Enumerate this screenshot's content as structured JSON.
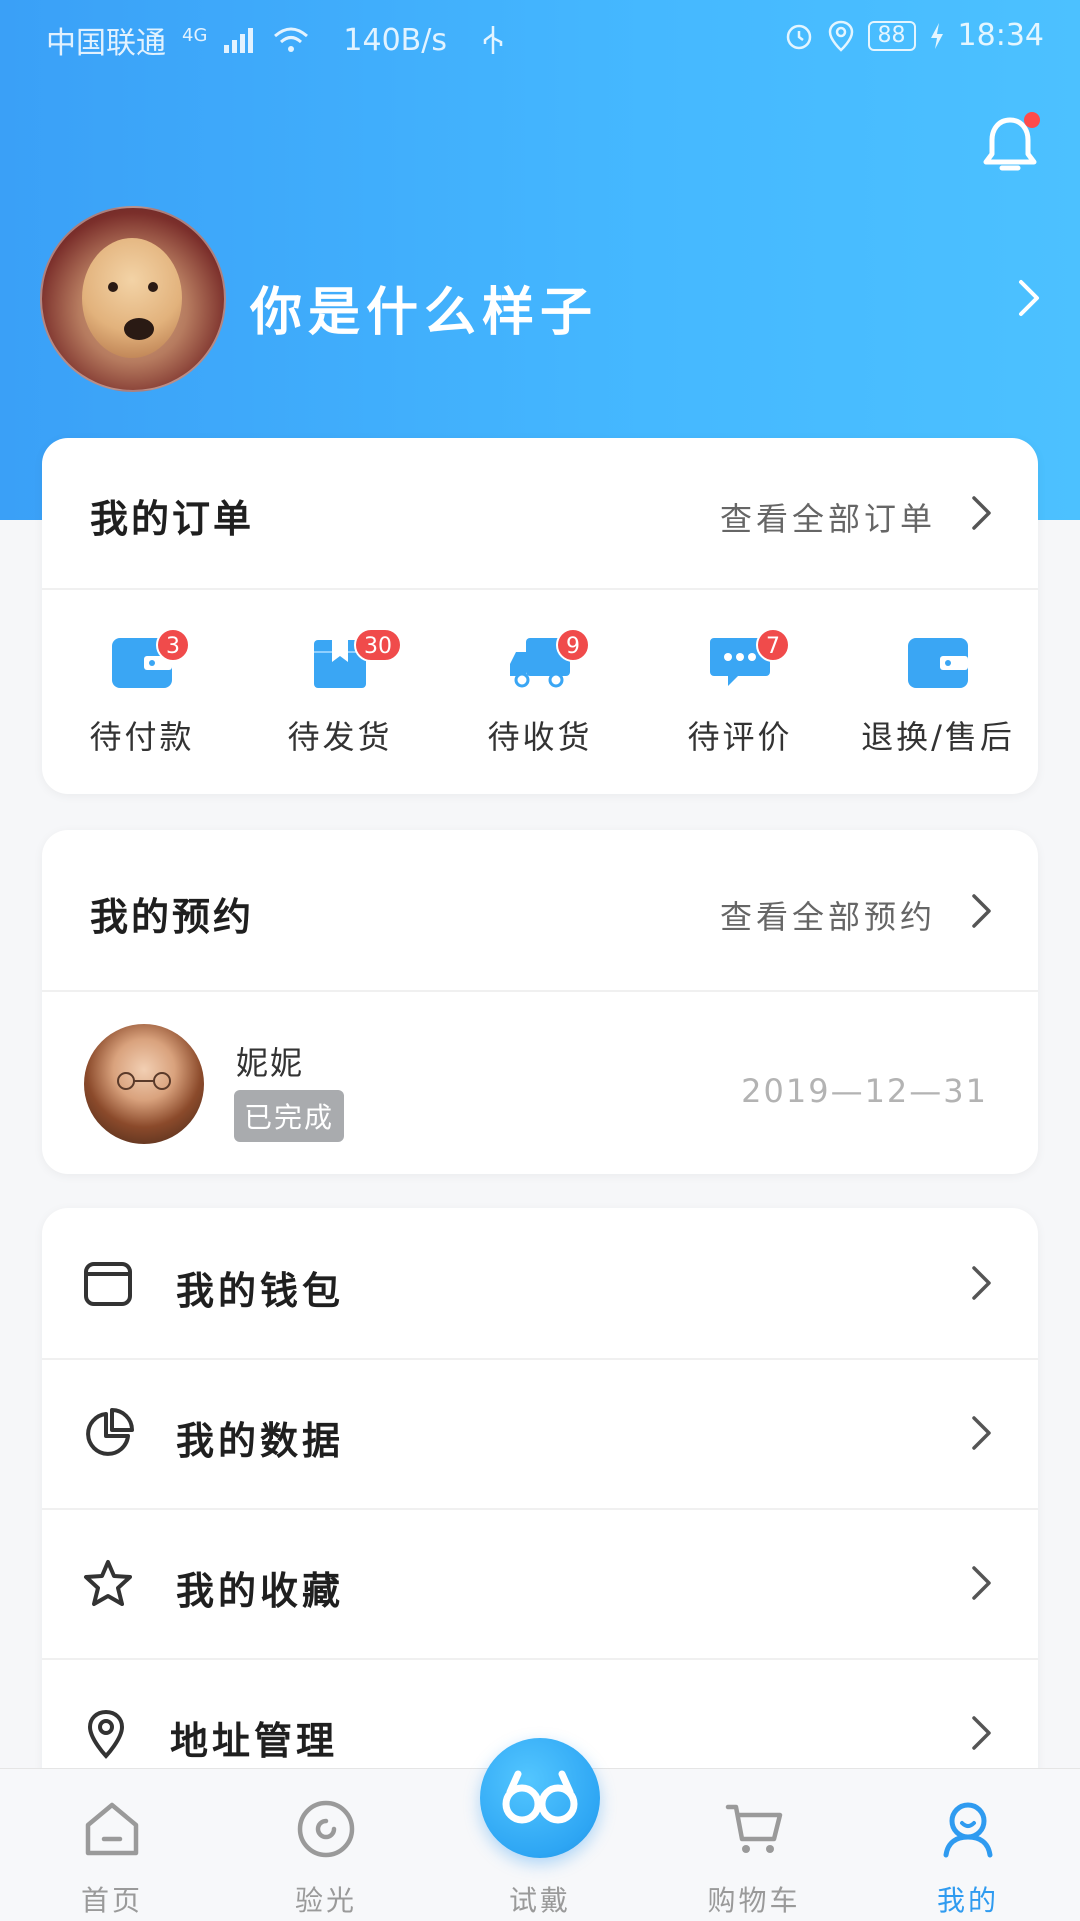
{
  "status_bar": {
    "carrier": "中国联通",
    "network": "4G",
    "speed": "140B/s",
    "battery": "88",
    "time": "18:34"
  },
  "profile": {
    "username": "你是什么样子"
  },
  "orders": {
    "title": "我的订单",
    "view_all": "查看全部订单",
    "items": [
      {
        "label": "待付款",
        "badge": "3",
        "icon": "wallet-icon"
      },
      {
        "label": "待发货",
        "badge": "30",
        "icon": "package-icon"
      },
      {
        "label": "待收货",
        "badge": "9",
        "icon": "truck-icon"
      },
      {
        "label": "待评价",
        "badge": "7",
        "icon": "chat-icon"
      },
      {
        "label": "退换/售后",
        "badge": "",
        "icon": "return-icon"
      }
    ]
  },
  "appointments": {
    "title": "我的预约",
    "view_all": "查看全部预约",
    "entry": {
      "name": "妮妮",
      "status": "已完成",
      "date": "2019—12—31"
    }
  },
  "menu": {
    "items": [
      {
        "label": "我的钱包",
        "icon": "wallet-outline-icon"
      },
      {
        "label": "我的数据",
        "icon": "pie-chart-icon"
      },
      {
        "label": "我的收藏",
        "icon": "star-icon"
      },
      {
        "label": "地址管理",
        "icon": "location-pin-icon"
      }
    ]
  },
  "tabbar": {
    "items": [
      {
        "label": "首页",
        "icon": "home-icon"
      },
      {
        "label": "验光",
        "icon": "eye-test-icon"
      },
      {
        "label": "试戴",
        "icon": "glasses-icon"
      },
      {
        "label": "购物车",
        "icon": "cart-icon"
      },
      {
        "label": "我的",
        "icon": "user-icon",
        "active": true
      }
    ]
  },
  "colors": {
    "accent": "#2f9bf0",
    "badge": "#f04b4b",
    "hero_start": "#3aa0f7",
    "hero_end": "#4cc1ff"
  }
}
